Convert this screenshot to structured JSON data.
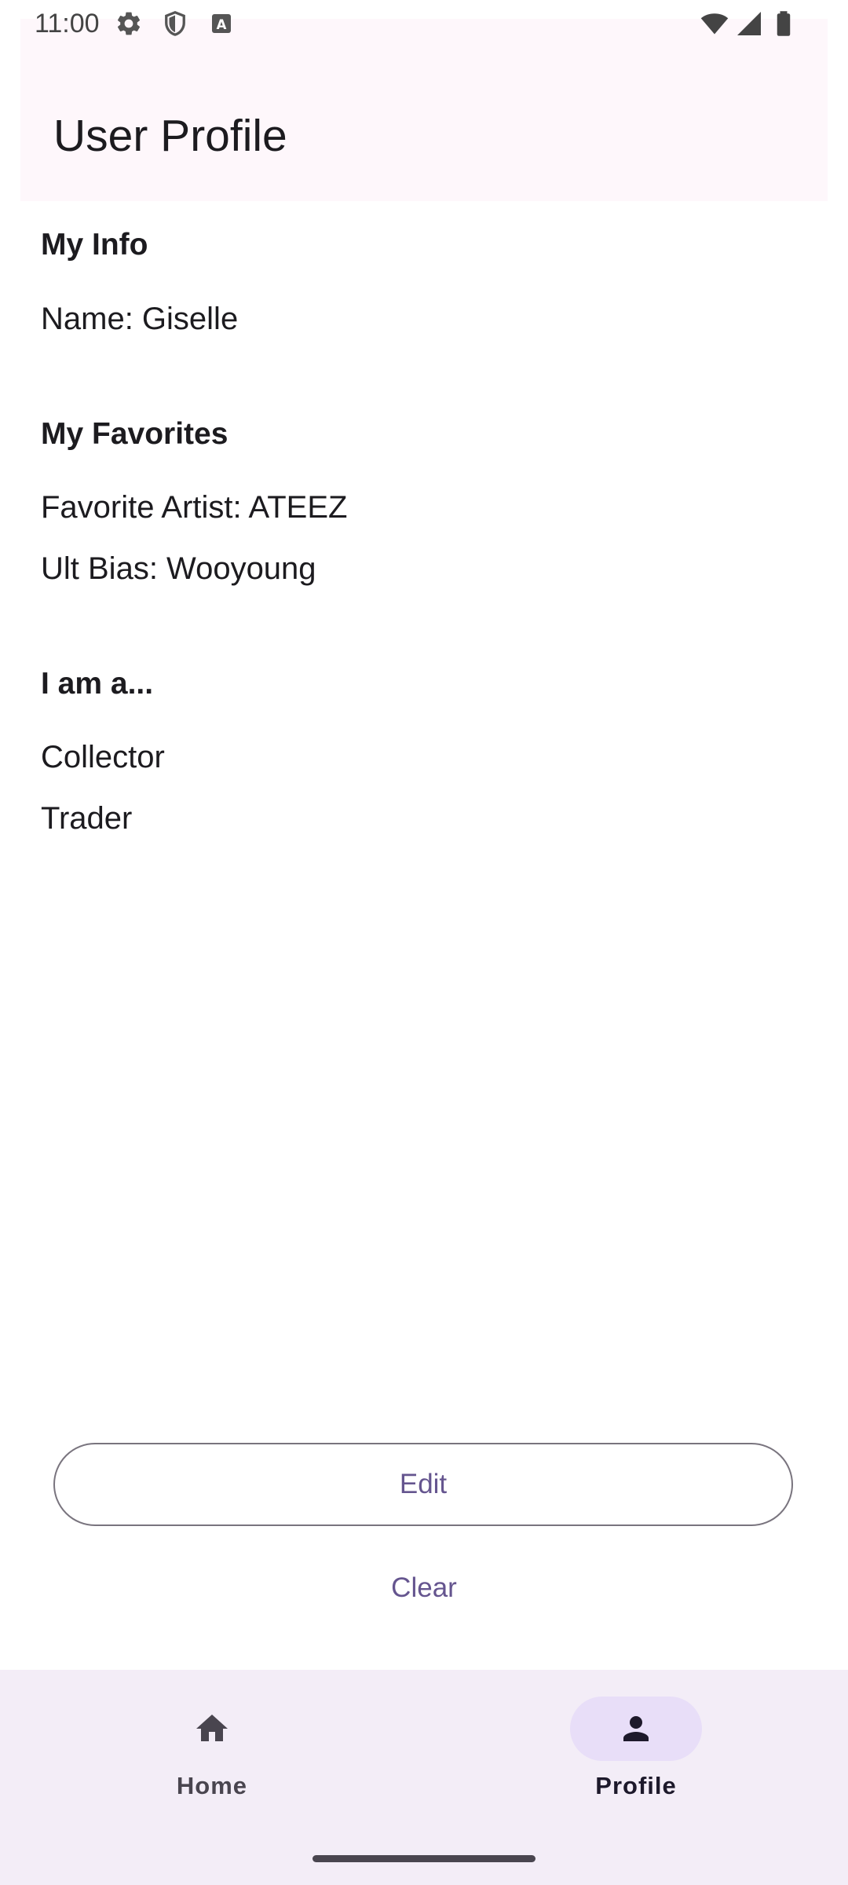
{
  "status_bar": {
    "time": "11:00"
  },
  "app_bar": {
    "title": "User Profile"
  },
  "sections": {
    "my_info": {
      "heading": "My Info",
      "lines": [
        "Name: Giselle"
      ]
    },
    "my_favorites": {
      "heading": "My Favorites",
      "lines": [
        "Favorite Artist: ATEEZ",
        "Ult Bias: Wooyoung"
      ]
    },
    "i_am_a": {
      "heading": "I am a...",
      "lines": [
        "Collector",
        "Trader"
      ]
    }
  },
  "actions": {
    "edit_label": "Edit",
    "clear_label": "Clear"
  },
  "bottom_nav": {
    "items": [
      {
        "label": "Home",
        "icon": "home-icon",
        "selected": false
      },
      {
        "label": "Profile",
        "icon": "person-icon",
        "selected": true
      }
    ]
  },
  "colors": {
    "primary": "#65558f",
    "app_bar_bg": "#fef7fb",
    "nav_bg": "#f3edf7",
    "nav_indicator": "#e8def8",
    "outline": "#79747e"
  }
}
